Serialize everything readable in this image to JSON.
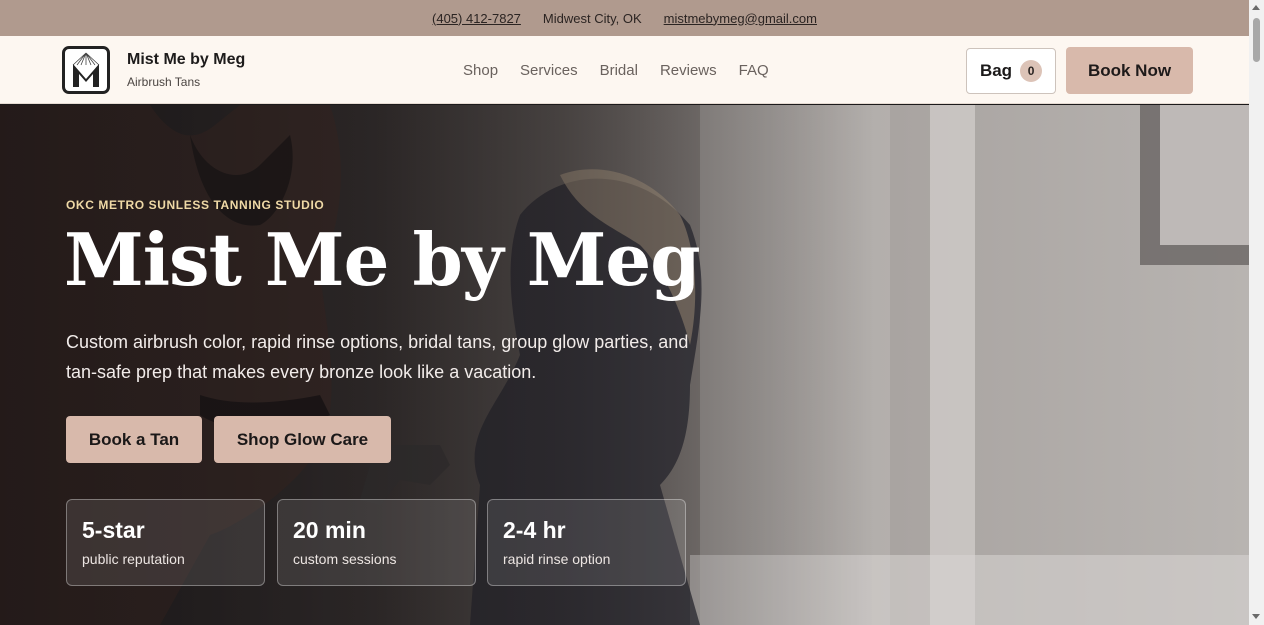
{
  "topbar": {
    "phone": "(405) 412-7827",
    "location": "Midwest City, OK",
    "email": "mistmebymeg@gmail.com"
  },
  "header": {
    "logo_letter": "M",
    "brand_name": "Mist Me by Meg",
    "brand_sub": "Airbrush Tans",
    "nav": [
      "Shop",
      "Services",
      "Bridal",
      "Reviews",
      "FAQ"
    ],
    "bag_label": "Bag",
    "bag_count": "0",
    "book_now": "Book Now"
  },
  "hero": {
    "eyebrow": "OKC METRO SUNLESS TANNING STUDIO",
    "title": "Mist Me by Meg",
    "description": "Custom airbrush color, rapid rinse options, bridal tans, group glow parties, and tan-safe prep that makes every bronze look like a vacation.",
    "cta_primary": "Book a Tan",
    "cta_secondary": "Shop Glow Care",
    "stats": [
      {
        "value": "5-star",
        "label": "public reputation"
      },
      {
        "value": "20 min",
        "label": "custom sessions"
      },
      {
        "value": "2-4 hr",
        "label": "rapid rinse option"
      }
    ]
  },
  "colors": {
    "topbar_bg": "#b09a8e",
    "nav_bg": "#fdf7f1",
    "accent": "#d8b9ab",
    "eyebrow": "#efd9a6"
  }
}
